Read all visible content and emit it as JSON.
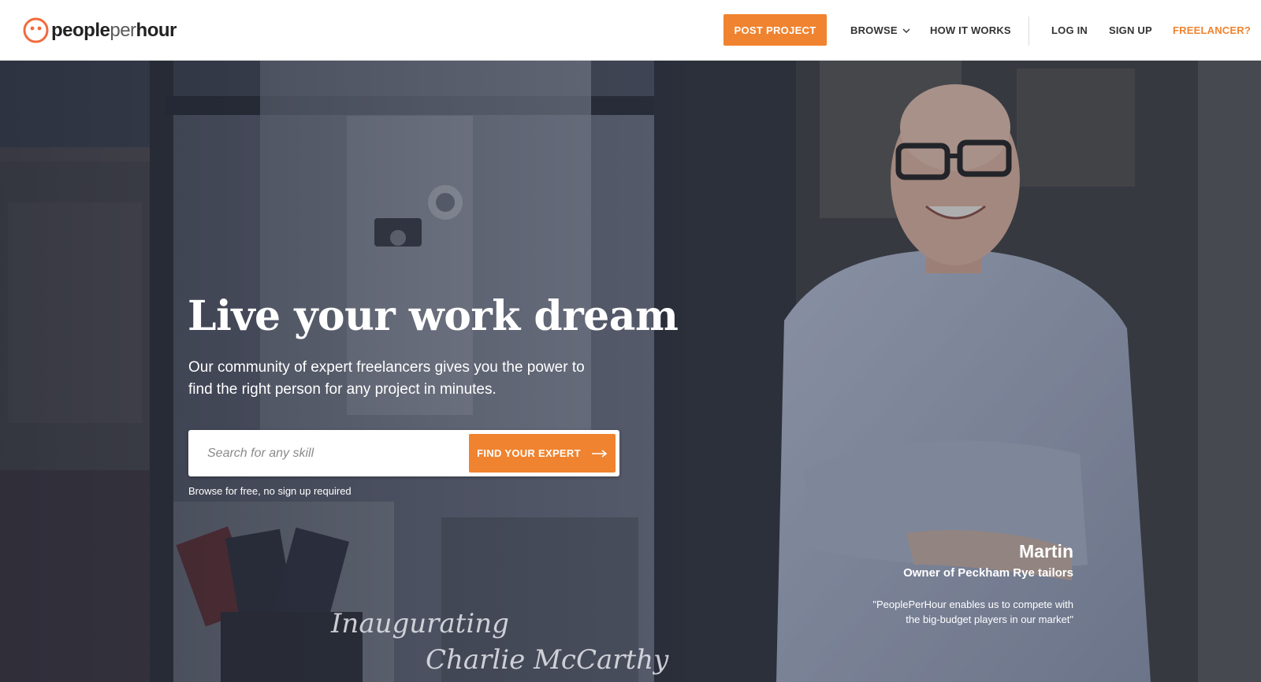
{
  "header": {
    "logo": {
      "part1": "people",
      "part2": "per",
      "part3": "hour"
    },
    "post_project": "POST PROJECT",
    "browse": "BROWSE",
    "how_it_works": "HOW IT WORKS",
    "log_in": "LOG IN",
    "sign_up": "SIGN UP",
    "freelancer": "FREELANCER?"
  },
  "hero": {
    "title": "Live your work dream",
    "subtitle": "Our community of expert freelancers gives you the power to find the right person for any project in minutes.",
    "search": {
      "placeholder": "Search for any skill",
      "value": ""
    },
    "find_button": "FIND YOUR EXPERT",
    "browse_note": "Browse for free, no sign up required",
    "testimonial": {
      "name": "Martin",
      "role": "Owner of Peckham Rye tailors",
      "quote": "\"PeoplePerHour enables us to compete with the big-budget players in our market\""
    }
  },
  "colors": {
    "accent": "#f0832f",
    "text_dark": "#333333",
    "hero_overlay": "#2f3442"
  },
  "icons": {
    "logo": "smiley-logo-icon",
    "browse_caret": "chevron-down-icon",
    "find_arrow": "arrow-right-icon"
  }
}
